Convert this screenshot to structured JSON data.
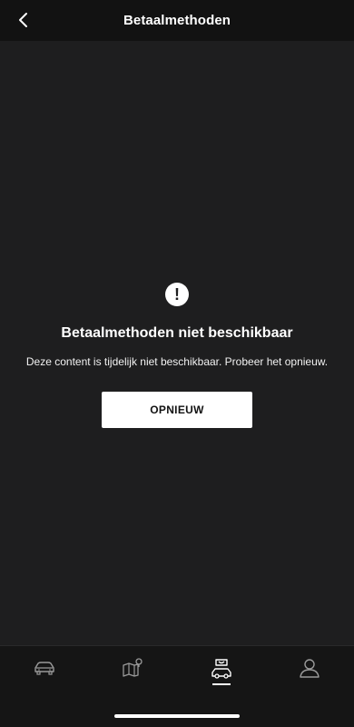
{
  "header": {
    "title": "Betaalmethoden"
  },
  "error": {
    "icon": "alert-circle-icon",
    "title": "Betaalmethoden niet beschikbaar",
    "message": "Deze content is tijdelijk niet beschikbaar. Probeer het opnieuw.",
    "retry_label": "OPNIEUW"
  },
  "tabbar": {
    "items": [
      {
        "icon": "car-icon",
        "active": false
      },
      {
        "icon": "map-pin-icon",
        "active": false
      },
      {
        "icon": "shopping-bag-car-icon",
        "active": true
      },
      {
        "icon": "profile-icon",
        "active": false
      }
    ]
  },
  "colors": {
    "background": "#1e1e1f",
    "header_background": "#121212",
    "tabbar_background": "#151515",
    "text": "#ffffff",
    "button_background": "#ffffff",
    "button_text": "#111111"
  }
}
